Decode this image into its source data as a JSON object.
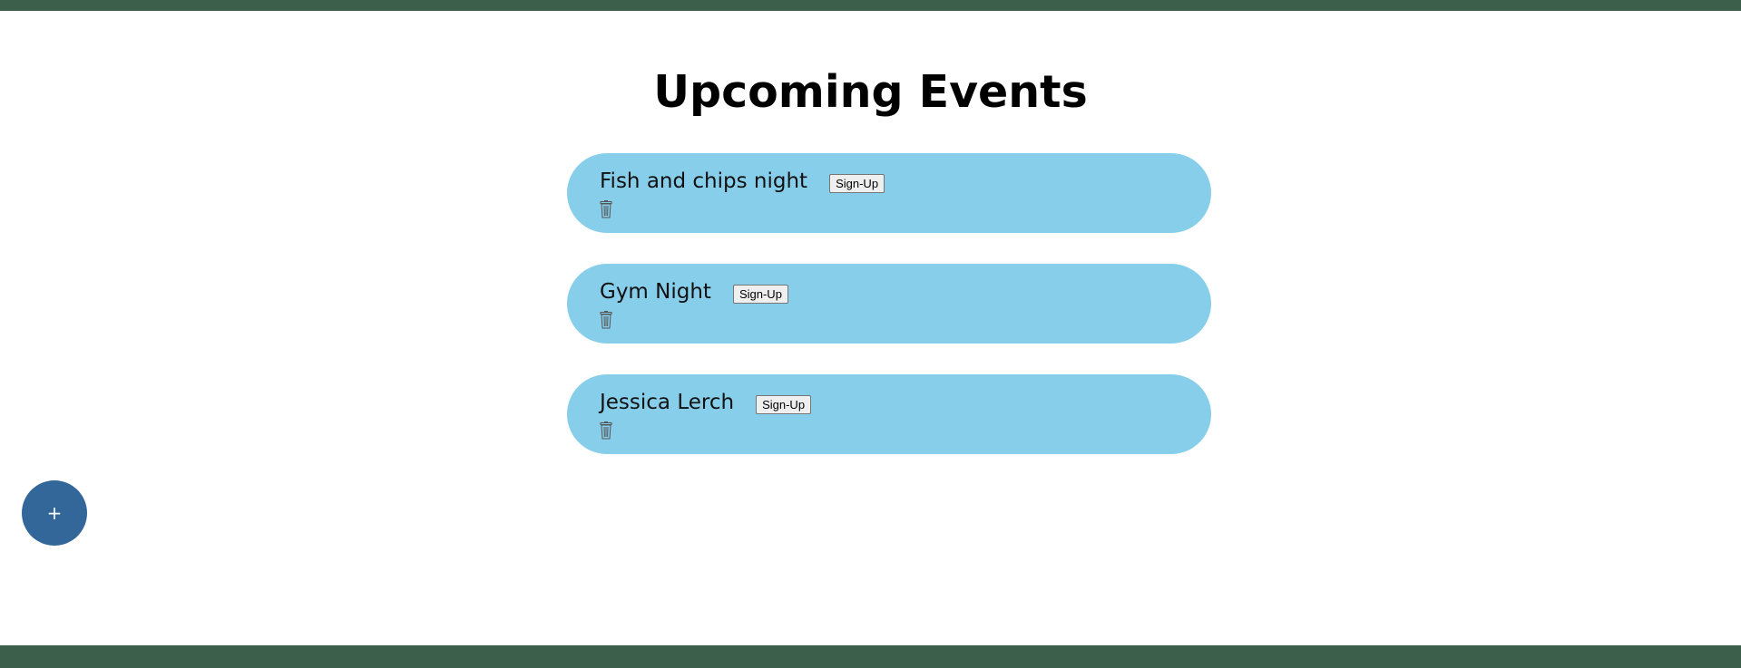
{
  "header": {
    "title": "Upcoming Events"
  },
  "events": [
    {
      "name": "Fish and chips night",
      "signup_label": "Sign-Up",
      "delete_icon": "trash-icon"
    },
    {
      "name": "Gym Night",
      "signup_label": "Sign-Up",
      "delete_icon": "trash-icon"
    },
    {
      "name": "Jessica Lerch",
      "signup_label": "Sign-Up",
      "delete_icon": "trash-icon"
    }
  ],
  "fab": {
    "label": "+"
  },
  "colors": {
    "bar": "#3b5f4b",
    "card": "#87ceeb",
    "fab": "#336699"
  }
}
